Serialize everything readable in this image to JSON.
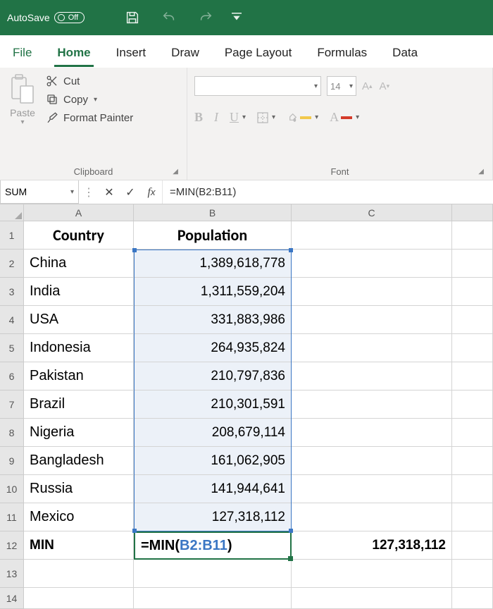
{
  "titlebar": {
    "autosave_label": "AutoSave",
    "autosave_state": "Off"
  },
  "tabs": {
    "file": "File",
    "home": "Home",
    "insert": "Insert",
    "draw": "Draw",
    "page_layout": "Page Layout",
    "formulas": "Formulas",
    "data": "Data"
  },
  "ribbon": {
    "clipboard": {
      "paste": "Paste",
      "cut": "Cut",
      "copy": "Copy",
      "format_painter": "Format Painter",
      "group_label": "Clipboard"
    },
    "font": {
      "size": "14",
      "group_label": "Font"
    }
  },
  "namebox": "SUM",
  "formula_bar": "=MIN(B2:B11)",
  "columns": [
    "A",
    "B",
    "C"
  ],
  "sheet": {
    "headers": {
      "a": "Country",
      "b": "Population"
    },
    "rows": [
      {
        "country": "China",
        "population": "1,389,618,778"
      },
      {
        "country": "India",
        "population": "1,311,559,204"
      },
      {
        "country": "USA",
        "population": "331,883,986"
      },
      {
        "country": "Indonesia",
        "population": "264,935,824"
      },
      {
        "country": "Pakistan",
        "population": "210,797,836"
      },
      {
        "country": "Brazil",
        "population": "210,301,591"
      },
      {
        "country": "Nigeria",
        "population": "208,679,114"
      },
      {
        "country": "Bangladesh",
        "population": "161,062,905"
      },
      {
        "country": "Russia",
        "population": "141,944,641"
      },
      {
        "country": "Mexico",
        "population": "127,318,112"
      }
    ],
    "row12": {
      "a": "MIN",
      "b_prefix": "=MIN(",
      "b_arg": "B2:B11",
      "b_suffix": ")",
      "c": "127,318,112"
    }
  },
  "chart_data": {
    "type": "table",
    "title": "",
    "columns": [
      "Country",
      "Population"
    ],
    "rows": [
      [
        "China",
        1389618778
      ],
      [
        "India",
        1311559204
      ],
      [
        "USA",
        331883986
      ],
      [
        "Indonesia",
        264935824
      ],
      [
        "Pakistan",
        210797836
      ],
      [
        "Brazil",
        210301591
      ],
      [
        "Nigeria",
        208679114
      ],
      [
        "Bangladesh",
        161062905
      ],
      [
        "Russia",
        141944641
      ],
      [
        "Mexico",
        127318112
      ]
    ],
    "aggregate": {
      "label": "MIN",
      "formula": "=MIN(B2:B11)",
      "value": 127318112
    }
  }
}
